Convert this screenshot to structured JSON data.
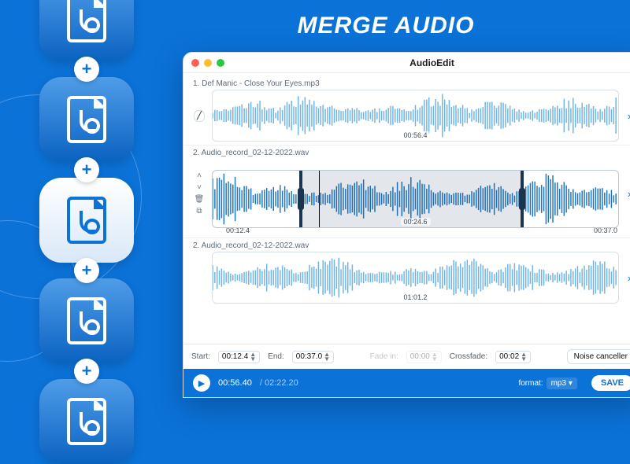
{
  "hero": {
    "title": "MERGE AUDIO"
  },
  "window": {
    "title": "AudioEdit"
  },
  "tracks": [
    {
      "index": "1.",
      "name": "Def Manic - Close Your Eyes.mp3",
      "duration": "00:56.4"
    },
    {
      "index": "2.",
      "name": "Audio_record_02-12-2022.wav",
      "duration": "00:24.6",
      "playhead": "00:13.2",
      "sel_start": "00:12.4",
      "sel_end": "00:37.0"
    },
    {
      "index": "2.",
      "name": "Audio_record_02-12-2022.wav",
      "duration": "01:01.2"
    }
  ],
  "controls": {
    "start_label": "Start:",
    "start": "00:12.4",
    "end_label": "End:",
    "end": "00:37.0",
    "fadein_label": "Fade in:",
    "fadein": "00:00",
    "crossfade_label": "Crossfade:",
    "crossfade": "00:02",
    "noise_btn": "Noise canceller"
  },
  "play": {
    "current": "00:56.40",
    "total": "02:22.20",
    "format_label": "format:",
    "format": "mp3",
    "save": "SAVE"
  }
}
